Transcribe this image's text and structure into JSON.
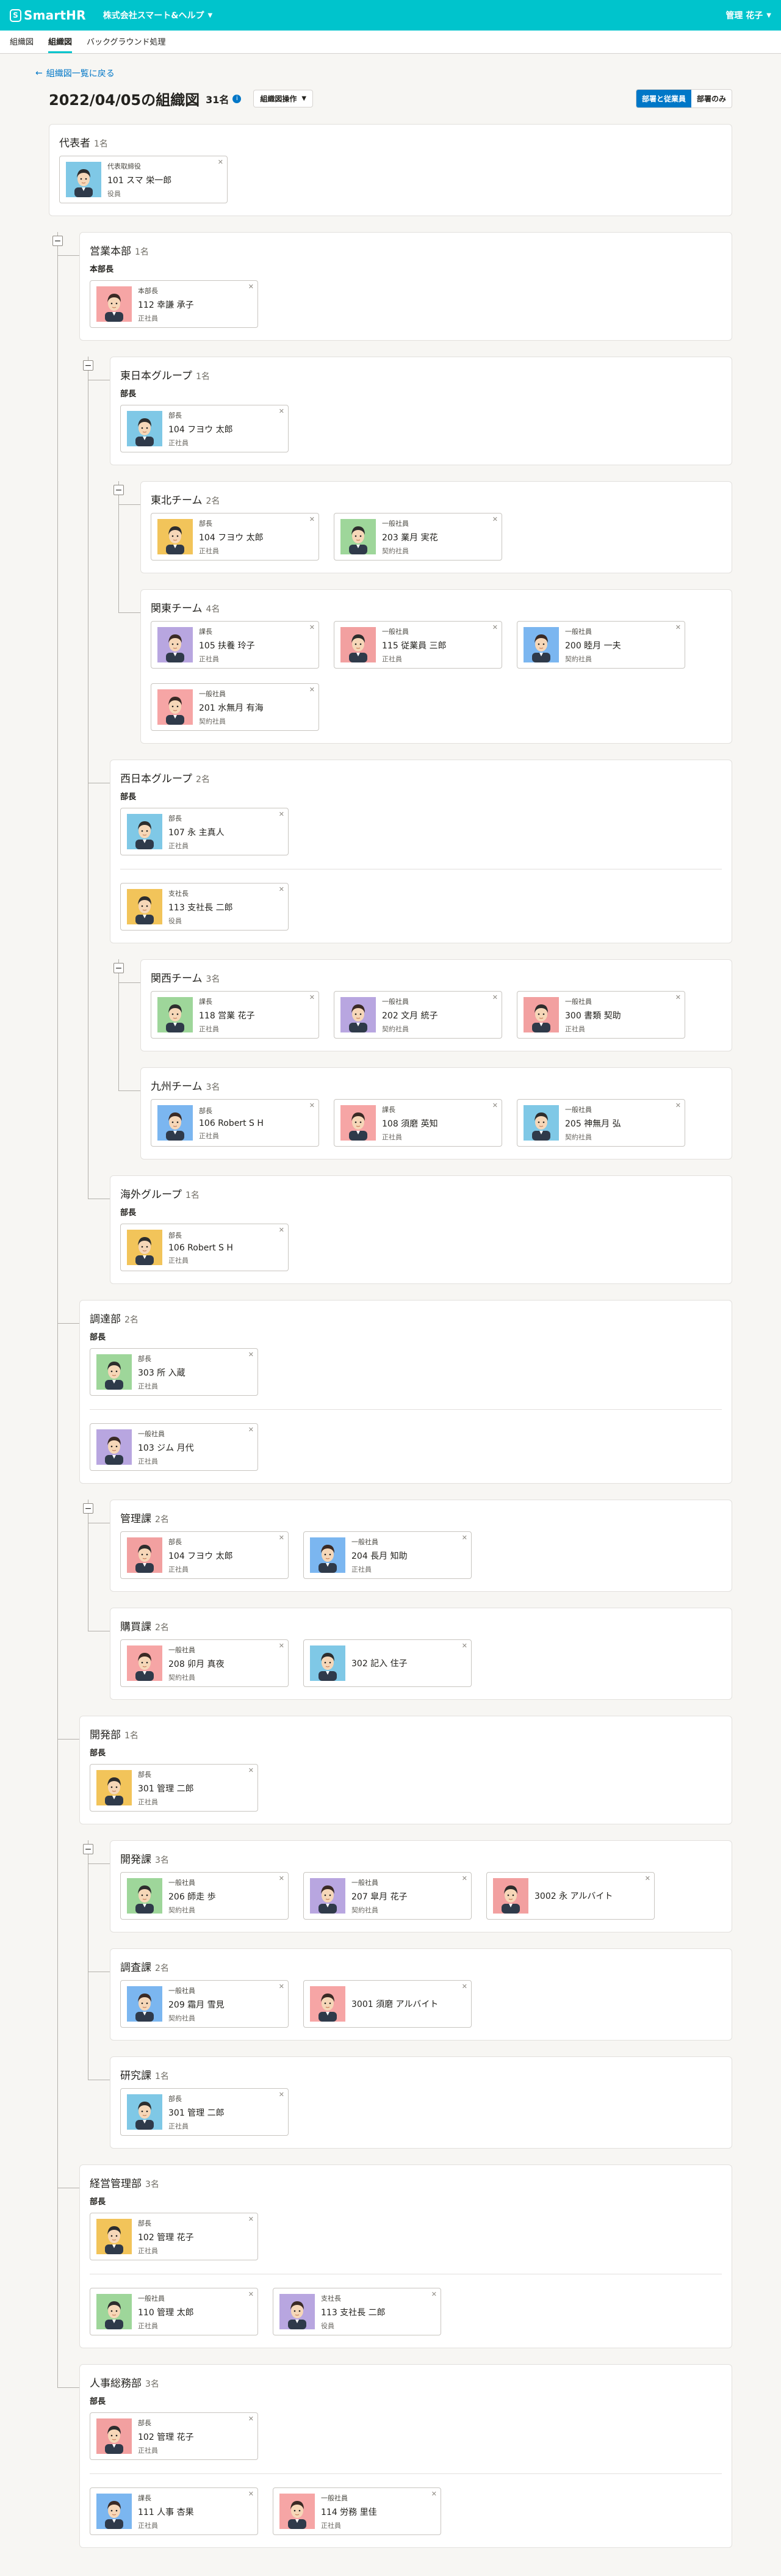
{
  "app": {
    "name": "SmartHR",
    "company": "株式会社スマート&ヘルプ",
    "user": "管理 花子"
  },
  "tabs": [
    "組織図",
    "組織図",
    "バックグラウンド処理"
  ],
  "back_label": "組織図一覧に戻る",
  "title": "2022/04/05の組織図",
  "count": "31名",
  "ops_label": "組織図操作",
  "toggle": {
    "on": "部署と従業員",
    "off": "部署のみ"
  },
  "ceo": {
    "name": "代表者",
    "count": "1名",
    "member": {
      "position": "代表取締役",
      "name": "101 スマ 栄一郎",
      "employment": "役員"
    }
  },
  "sales": {
    "name": "営業本部",
    "count": "1名",
    "role": "本部長",
    "member": {
      "position": "本部長",
      "name": "112 幸謙 承子",
      "employment": "正社員"
    }
  },
  "east": {
    "name": "東日本グループ",
    "count": "1名",
    "role": "部長",
    "member": {
      "position": "部長",
      "name": "104 フヨウ 太郎",
      "employment": "正社員"
    }
  },
  "tohoku": {
    "name": "東北チーム",
    "count": "2名",
    "members": [
      {
        "position": "部長",
        "name": "104 フヨウ 太郎",
        "employment": "正社員"
      },
      {
        "position": "一般社員",
        "name": "203 業月 実花",
        "employment": "契約社員"
      }
    ]
  },
  "kanto": {
    "name": "関東チーム",
    "count": "4名",
    "members": [
      {
        "position": "課長",
        "name": "105 扶養 玲子",
        "employment": "正社員"
      },
      {
        "position": "一般社員",
        "name": "115 従業員 三郎",
        "employment": "正社員"
      },
      {
        "position": "一般社員",
        "name": "200 睦月 一夫",
        "employment": "契約社員"
      },
      {
        "position": "一般社員",
        "name": "201 水無月 有海",
        "employment": "契約社員"
      }
    ]
  },
  "west": {
    "name": "西日本グループ",
    "count": "2名",
    "role": "部長",
    "member": {
      "position": "部長",
      "name": "107 永 主真人",
      "employment": "正社員"
    },
    "other": {
      "position": "支社長",
      "name": "113 支社長 二郎",
      "employment": "役員"
    }
  },
  "kansai": {
    "name": "関西チーム",
    "count": "3名",
    "members": [
      {
        "position": "課長",
        "name": "118 営業 花子",
        "employment": "正社員"
      },
      {
        "position": "一般社員",
        "name": "202 文月 統子",
        "employment": "契約社員"
      },
      {
        "position": "一般社員",
        "name": "300 書類 契助",
        "employment": "正社員"
      }
    ]
  },
  "kyushu": {
    "name": "九州チーム",
    "count": "3名",
    "members": [
      {
        "position": "部長",
        "name": "106 Robert S H",
        "employment": "正社員"
      },
      {
        "position": "課長",
        "name": "108 須磨 英知",
        "employment": "正社員"
      },
      {
        "position": "一般社員",
        "name": "205 神無月 弘",
        "employment": "契約社員"
      }
    ]
  },
  "overseas": {
    "name": "海外グループ",
    "count": "1名",
    "role": "部長",
    "member": {
      "position": "部長",
      "name": "106 Robert S H",
      "employment": "正社員"
    }
  },
  "procure": {
    "name": "調達部",
    "count": "2名",
    "role": "部長",
    "member": {
      "position": "部長",
      "name": "303 所 入蔵",
      "employment": "正社員"
    },
    "other": {
      "position": "一般社員",
      "name": "103 ジム 月代",
      "employment": "正社員"
    }
  },
  "admin": {
    "name": "管理課",
    "count": "2名",
    "members": [
      {
        "position": "部長",
        "name": "104 フヨウ 太郎",
        "employment": "正社員"
      },
      {
        "position": "一般社員",
        "name": "204 長月 知助",
        "employment": "正社員"
      }
    ]
  },
  "purchase": {
    "name": "購買課",
    "count": "2名",
    "members": [
      {
        "position": "一般社員",
        "name": "208 卯月 真夜",
        "employment": "契約社員"
      },
      {
        "position": "",
        "name": "302 記入 住子",
        "employment": ""
      }
    ]
  },
  "dev": {
    "name": "開発部",
    "count": "1名",
    "role": "部長",
    "member": {
      "position": "部長",
      "name": "301 管理 二郎",
      "employment": "正社員"
    }
  },
  "devsec": {
    "name": "開発課",
    "count": "3名",
    "members": [
      {
        "position": "一般社員",
        "name": "206 師走 歩",
        "employment": "契約社員"
      },
      {
        "position": "一般社員",
        "name": "207 皐月 花子",
        "employment": "契約社員"
      },
      {
        "position": "",
        "name": "3002 永 アルバイト",
        "employment": ""
      }
    ]
  },
  "research": {
    "name": "調査課",
    "count": "2名",
    "members": [
      {
        "position": "一般社員",
        "name": "209 霜月 雪見",
        "employment": "契約社員"
      },
      {
        "position": "",
        "name": "3001 須磨 アルバイト",
        "employment": ""
      }
    ]
  },
  "study": {
    "name": "研究課",
    "count": "1名",
    "members": [
      {
        "position": "部長",
        "name": "301 管理 二郎",
        "employment": "正社員"
      }
    ]
  },
  "mgmt": {
    "name": "経営管理部",
    "count": "3名",
    "role": "部長",
    "member": {
      "position": "部長",
      "name": "102 管理 花子",
      "employment": "正社員"
    },
    "others": [
      {
        "position": "一般社員",
        "name": "110 管理 太郎",
        "employment": "正社員"
      },
      {
        "position": "支社長",
        "name": "113 支社長 二郎",
        "employment": "役員"
      }
    ]
  },
  "hr": {
    "name": "人事総務部",
    "count": "3名",
    "role": "部長",
    "member": {
      "position": "部長",
      "name": "102 管理 花子",
      "employment": "正社員"
    },
    "others": [
      {
        "position": "課長",
        "name": "111 人事 杏果",
        "employment": "正社員"
      },
      {
        "position": "一般社員",
        "name": "114 労務 里佳",
        "employment": "正社員"
      }
    ]
  },
  "colors": {
    "brand": "#00c4cc",
    "link": "#0077c7"
  }
}
